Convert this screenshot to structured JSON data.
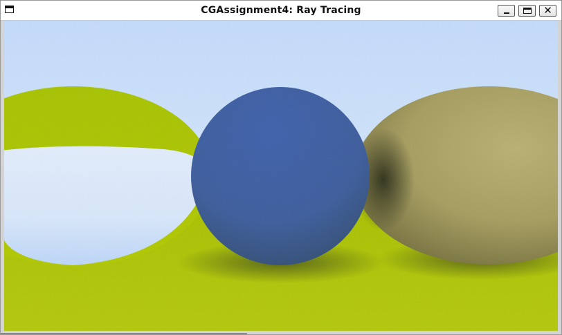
{
  "window": {
    "title": "CGAssignment4: Ray Tracing",
    "icon": "window-app-icon",
    "controls": {
      "minimize_icon": "minimize-icon",
      "maximize_icon": "maximize-icon",
      "close_icon": "close-icon",
      "close_glyph": "✕"
    }
  },
  "render": {
    "colors": {
      "sky_top": "#c3dbfb",
      "sky_bottom": "#e6f0fc",
      "ground": "#a8c200",
      "blue_sphere": "#3e5fa8",
      "metal_sphere": "#b0a86a",
      "left_sphere_rim": "#adc400"
    }
  }
}
